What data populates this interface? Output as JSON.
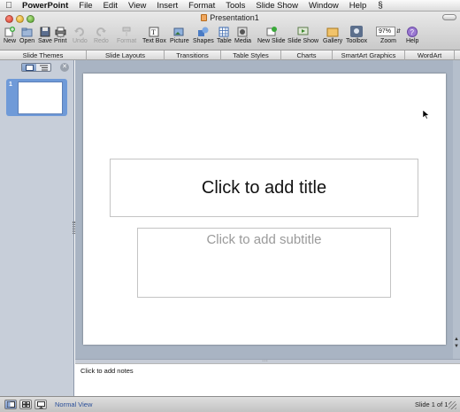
{
  "menubar": {
    "app_name": "PowerPoint",
    "items": [
      "File",
      "Edit",
      "View",
      "Insert",
      "Format",
      "Tools",
      "Slide Show",
      "Window",
      "Help"
    ]
  },
  "window": {
    "title": "Presentation1"
  },
  "toolbar": {
    "new": "New",
    "open": "Open",
    "save": "Save",
    "print": "Print",
    "undo": "Undo",
    "redo": "Redo",
    "format": "Format",
    "text_box": "Text Box",
    "picture": "Picture",
    "shapes": "Shapes",
    "table": "Table",
    "media": "Media",
    "new_slide": "New Slide",
    "slide_show": "Slide Show",
    "gallery": "Gallery",
    "toolbox": "Toolbox",
    "zoom_value": "97%",
    "zoom": "Zoom",
    "help": "Help"
  },
  "ribbon": {
    "tabs": [
      "Slide Themes",
      "Slide Layouts",
      "Transitions",
      "Table Styles",
      "Charts",
      "SmartArt Graphics",
      "WordArt"
    ]
  },
  "slides_panel": {
    "slide_number": "1"
  },
  "slide": {
    "title_placeholder": "Click to add title",
    "subtitle_placeholder": "Click to add subtitle"
  },
  "notes": {
    "placeholder": "Click to add notes"
  },
  "statusbar": {
    "view_name": "Normal View",
    "slide_position": "Slide 1 of 1"
  },
  "colors": {
    "accent": "#6f9ad8",
    "workspace": "#a9b4c3",
    "panel": "#c7ced9"
  }
}
